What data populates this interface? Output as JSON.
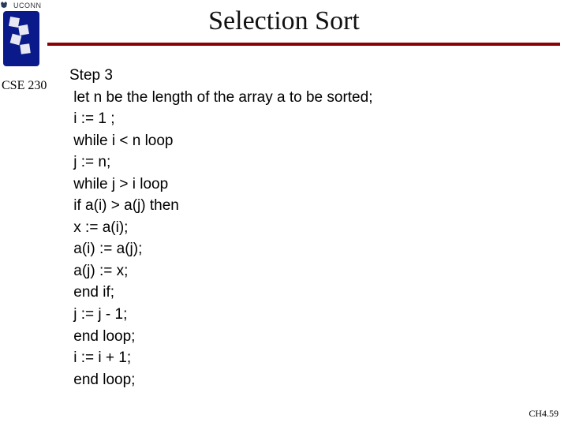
{
  "header": {
    "institution": "UCONN",
    "courseLabel": "CSE 230",
    "title": "Selection Sort"
  },
  "code": {
    "lines": [
      "Step 3",
      " let n be the length of the array a to be sorted;",
      " i := 1 ;",
      " while i < n loop",
      " j := n;",
      " while j > i loop",
      " if a(i) > a(j) then",
      " x := a(i);",
      " a(i) := a(j);",
      " a(j) := x;",
      " end if;",
      " j := j - 1;",
      " end loop;",
      " i := i + 1;",
      " end loop;"
    ]
  },
  "footer": {
    "pageRef": "CH4.59"
  },
  "icons": {
    "logoName": "uconn-cube-logo"
  }
}
